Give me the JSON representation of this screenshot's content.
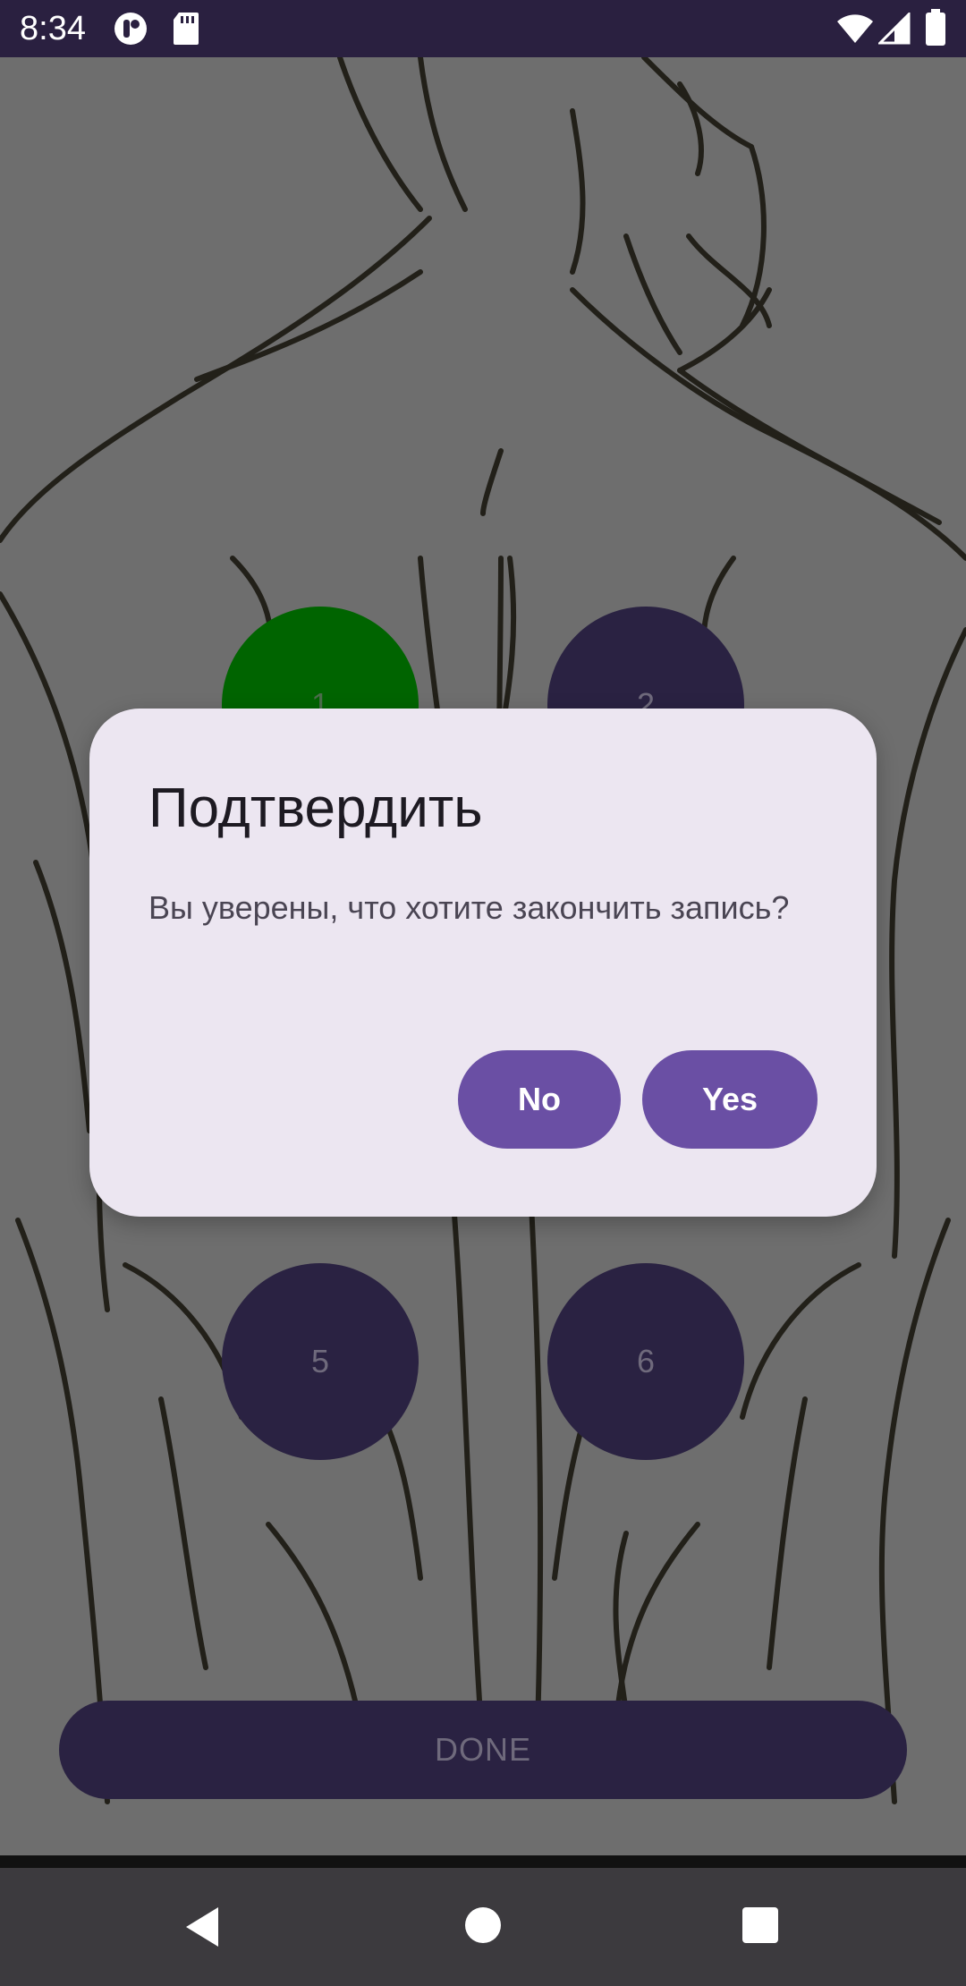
{
  "status_bar": {
    "time": "8:34",
    "icons": [
      "app-notification-icon",
      "sd-card-icon",
      "wifi-icon",
      "signal-icon",
      "battery-icon"
    ]
  },
  "points": [
    {
      "label": "1",
      "state": "active"
    },
    {
      "label": "2",
      "state": "inactive"
    },
    {
      "label": "5",
      "state": "inactive"
    },
    {
      "label": "6",
      "state": "inactive"
    }
  ],
  "done_button": {
    "label": "DONE"
  },
  "dialog": {
    "title": "Подтвердить",
    "message": "Вы уверены, что хотите закончить запись?",
    "no_label": "No",
    "yes_label": "Yes"
  },
  "colors": {
    "status_bar": "#2a2040",
    "active_point": "#006400",
    "point": "#2a2242",
    "dialog_bg": "#ece6f1",
    "dialog_button": "#6a4fa4",
    "nav_bar": "#3c3a3e"
  },
  "nav_bar": {
    "icons": [
      "back-icon",
      "home-icon",
      "recents-icon"
    ]
  }
}
